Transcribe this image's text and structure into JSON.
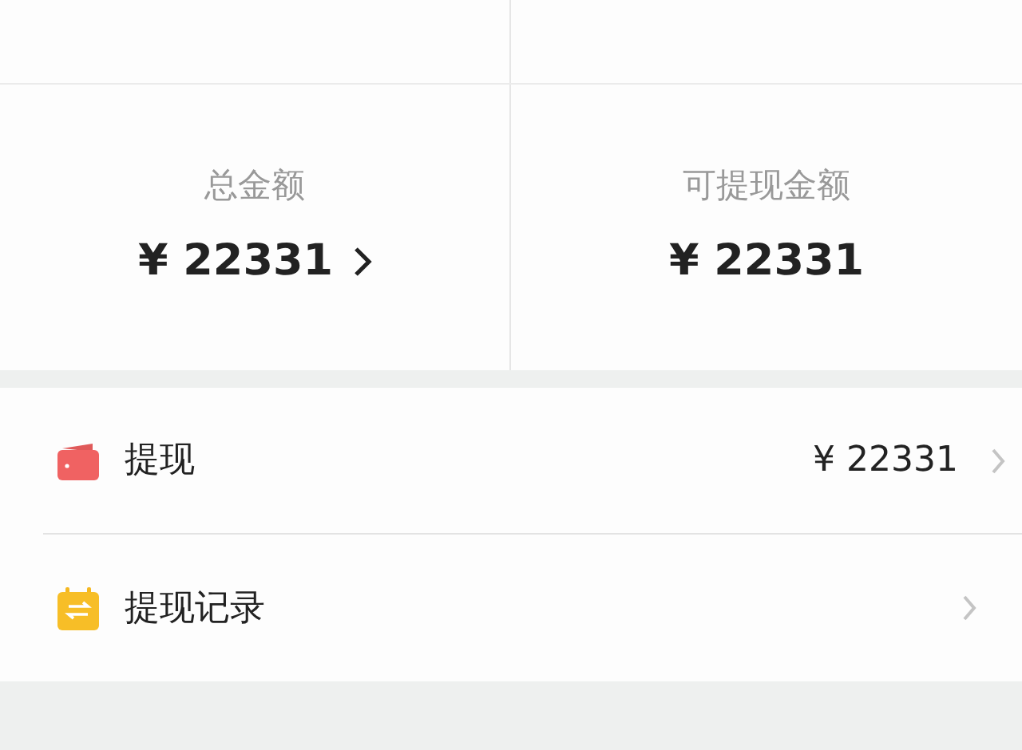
{
  "summary": [
    {
      "label": "总金额",
      "amount": "¥ 22331",
      "link": true
    },
    {
      "label": "可提现金额",
      "amount": "¥ 22331",
      "link": false
    }
  ],
  "menu": [
    {
      "kind": "wallet",
      "label": "提现",
      "value": "¥ 22331"
    },
    {
      "kind": "record",
      "label": "提现记录"
    }
  ]
}
